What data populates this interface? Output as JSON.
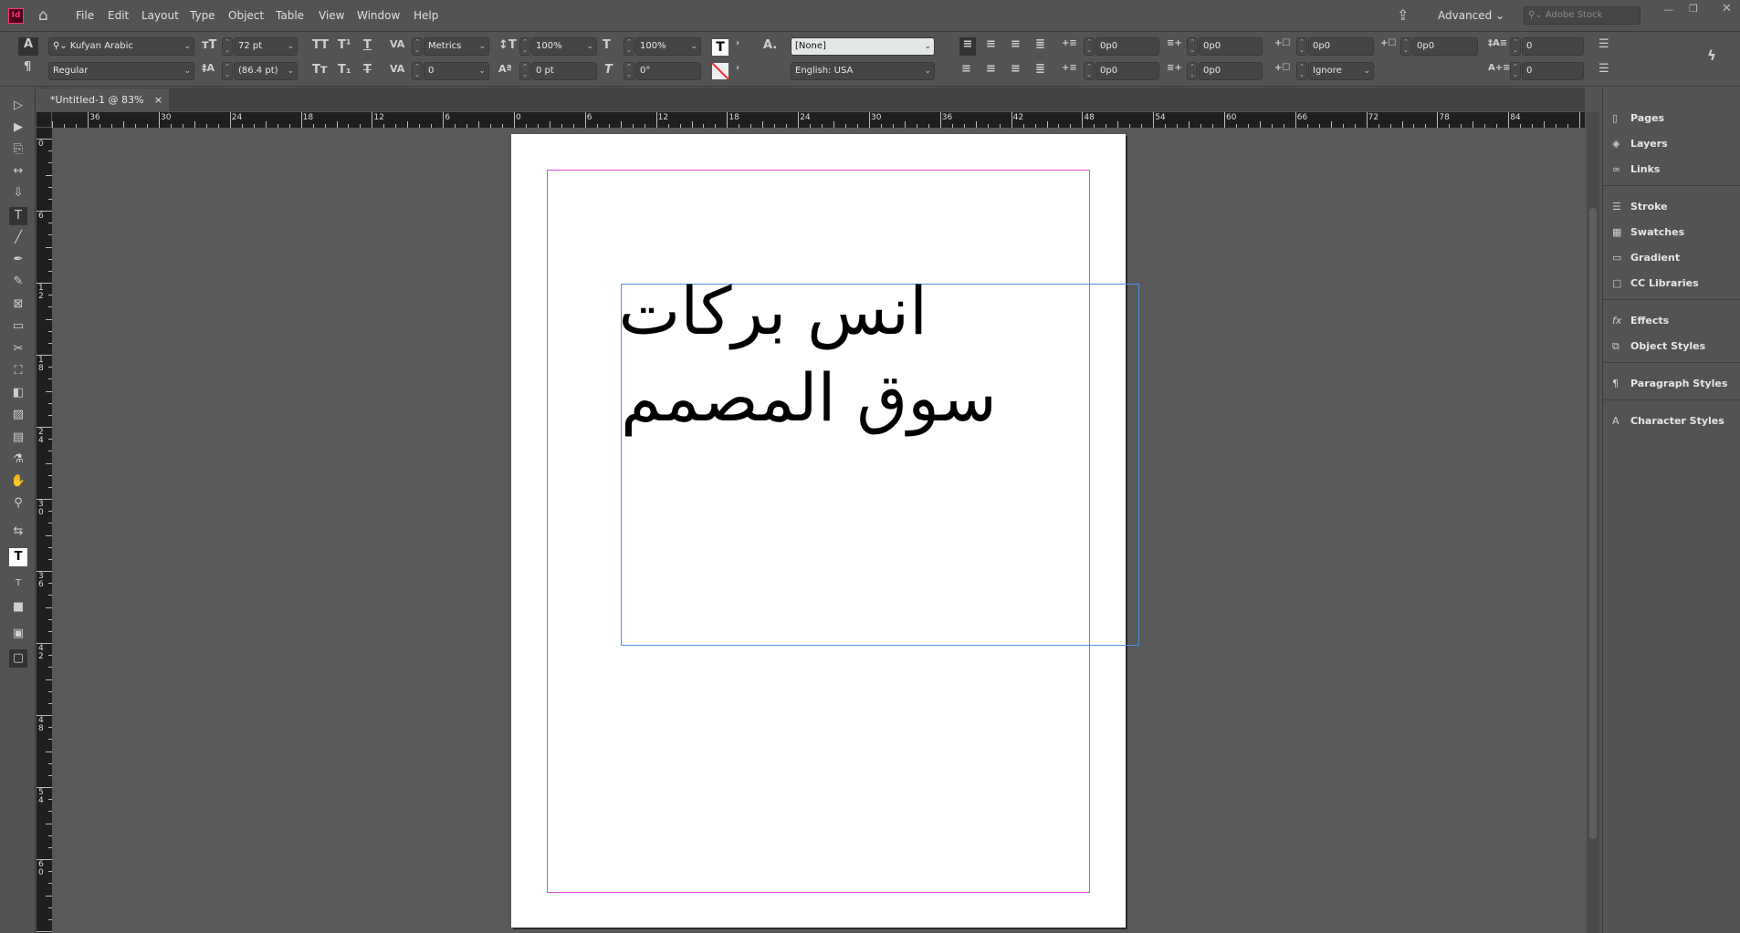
{
  "app": {
    "logo": "Id",
    "home_icon": "home-icon"
  },
  "menu": [
    "File",
    "Edit",
    "Layout",
    "Type",
    "Object",
    "Table",
    "View",
    "Window",
    "Help"
  ],
  "topbar": {
    "workspace": "Advanced",
    "search_placeholder": "Adobe Stock"
  },
  "control": {
    "font_family": "Kufyan Arabic",
    "font_style": "Regular",
    "font_size": "72 pt",
    "leading": "(86.4 pt)",
    "kerning": "Metrics",
    "tracking": "0",
    "vertical_scale": "100%",
    "horizontal_scale": "100%",
    "baseline_shift": "0 pt",
    "skew": "0°",
    "char_style": "[None]",
    "language": "English: USA",
    "left_indent": "0p0",
    "right_indent": "0p0",
    "first_line_indent": "0p0",
    "last_line_indent": "0p0",
    "space_before": "0p0",
    "space_after": "0p0",
    "grid_align": "Ignore",
    "drop_cap_lines": "0",
    "drop_cap_chars": "0"
  },
  "document": {
    "tab_label": "*Untitled-1 @ 83%",
    "close": "×"
  },
  "rulers": {
    "horizontal": [
      "36",
      "30",
      "24",
      "18",
      "12",
      "6",
      "0",
      "6",
      "12",
      "18",
      "24",
      "30",
      "36",
      "42",
      "48",
      "54",
      "60",
      "66",
      "72",
      "78",
      "84"
    ],
    "vertical": [
      "0",
      "6",
      "12",
      "18",
      "24",
      "30",
      "36",
      "42",
      "48",
      "54",
      "60"
    ]
  },
  "text": {
    "line1": "انس بركات",
    "line2": "سوق المصمم"
  },
  "colors": {
    "margin": "#d04cd8",
    "frame": "#4a90e8",
    "ui": "#535353"
  },
  "panels": [
    {
      "label": "Pages",
      "icon": "pages-icon"
    },
    {
      "label": "Layers",
      "icon": "layers-icon"
    },
    {
      "label": "Links",
      "icon": "links-icon"
    },
    {
      "label": "Stroke",
      "icon": "stroke-icon"
    },
    {
      "label": "Swatches",
      "icon": "swatches-icon"
    },
    {
      "label": "Gradient",
      "icon": "gradient-icon"
    },
    {
      "label": "CC Libraries",
      "icon": "cc-libraries-icon"
    },
    {
      "label": "Effects",
      "icon": "fx-icon"
    },
    {
      "label": "Object Styles",
      "icon": "object-styles-icon"
    },
    {
      "label": "Paragraph Styles",
      "icon": "paragraph-styles-icon"
    },
    {
      "label": "Character Styles",
      "icon": "character-styles-icon"
    }
  ]
}
